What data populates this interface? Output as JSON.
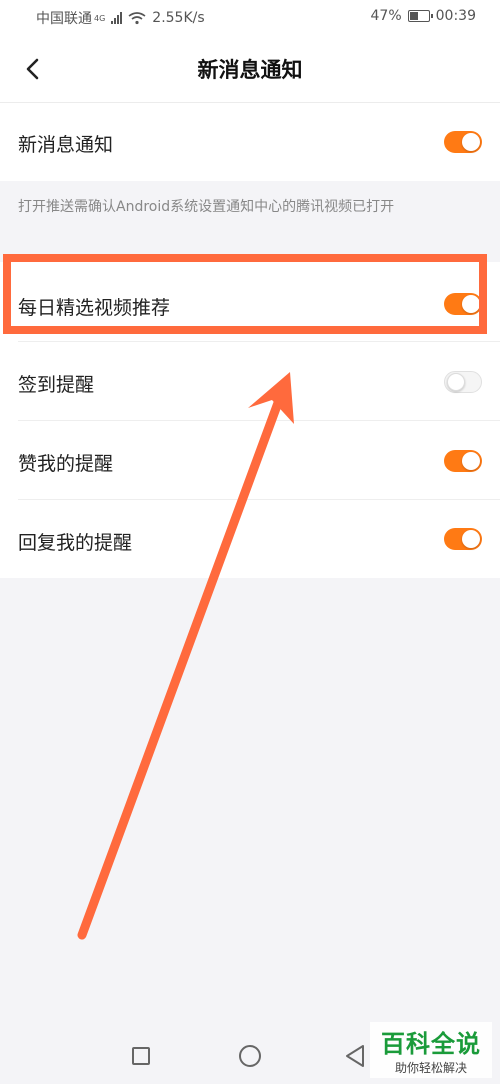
{
  "status_bar": {
    "carrier": "中国联通",
    "network": "4G",
    "speed": "2.55K/s",
    "battery": "47%",
    "time": "00:39"
  },
  "header": {
    "title": "新消息通知",
    "back_icon": "chevron-left-icon"
  },
  "settings": [
    {
      "label": "新消息通知",
      "enabled": true
    },
    {
      "label": "每日精选视频推荐",
      "enabled": true
    },
    {
      "label": "签到提醒",
      "enabled": false
    },
    {
      "label": "赞我的提醒",
      "enabled": true
    },
    {
      "label": "回复我的提醒",
      "enabled": true
    }
  ],
  "hint": "打开推送需确认Android系统设置通知中心的腾讯视频已打开",
  "colors": {
    "accent": "#ff7a14",
    "annotation": "#ff6a3d",
    "watermark": "#1a9b3a"
  },
  "watermark": {
    "title": "百科全说",
    "subtitle": "助你轻松解决"
  }
}
